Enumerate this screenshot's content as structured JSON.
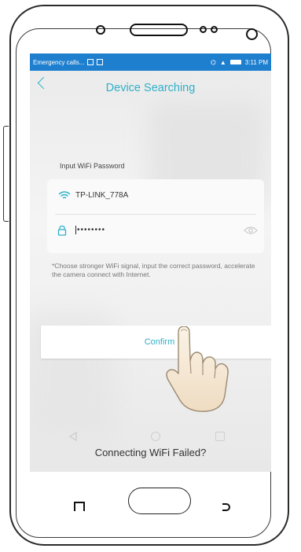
{
  "status_bar": {
    "left_text": "Emergency calls...",
    "time": "3:11 PM",
    "color": "#1e7fcf"
  },
  "header": {
    "back_icon": "chevron-left-icon",
    "title": "Device Searching",
    "accent": "#2fb0c9"
  },
  "form": {
    "section_label": "Input WiFi Password",
    "wifi_icon": "wifi-icon",
    "network_name": "TP-LINK_778A",
    "lock_icon": "lock-icon",
    "password_value": "••••••••",
    "eye_icon": "eye-icon",
    "hint": "*Choose stronger WiFi signal, input the correct password, accelerate the camera connect with Internet."
  },
  "confirm_button": {
    "label": "Confirm"
  },
  "footer": {
    "failed_link": "Connecting WiFi Failed?"
  },
  "nav": {
    "back": "nav-back-icon",
    "home": "nav-home-icon",
    "recent": "nav-recent-icon"
  }
}
